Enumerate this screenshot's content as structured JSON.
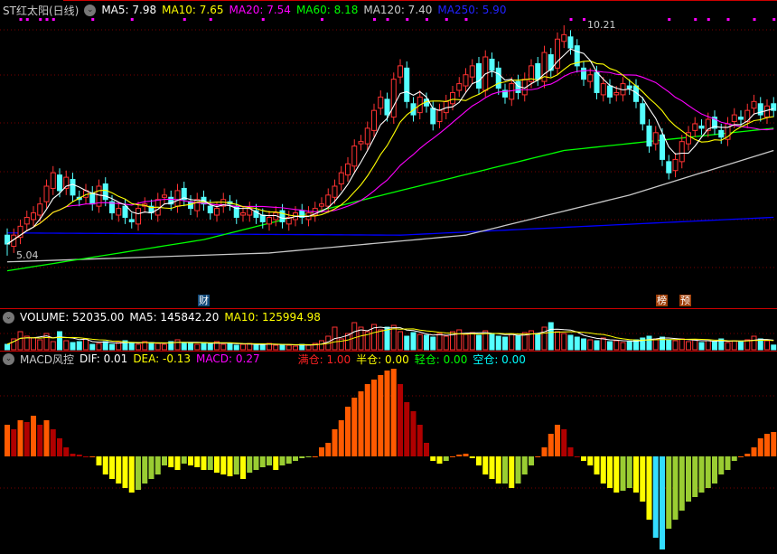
{
  "header": {
    "title": "ST红太阳(日线)",
    "ma5": "MA5: 7.98",
    "ma10": "MA10: 7.65",
    "ma20": "MA20: 7.54",
    "ma60": "MA60: 8.18",
    "ma120": "MA120: 7.40",
    "ma250": "MA250: 5.90"
  },
  "volume_header": {
    "title": "VOLUME: 52035.00",
    "ma5": "MA5: 145842.20",
    "ma10": "MA10: 125994.98"
  },
  "macd_header": {
    "title": "MACD风控",
    "dif": "DIF: 0.01",
    "dea": "DEA: -0.13",
    "macd": "MACD: 0.27",
    "full": "满仓: 1.00",
    "half": "半仓: 0.00",
    "light": "轻仓: 0.00",
    "empty": "空仓: 0.00"
  },
  "markers": {
    "cai": "财",
    "bang": "榜",
    "yu": "预"
  },
  "price_labels": {
    "high": "10.21",
    "low": "5.04"
  },
  "colors": {
    "up": "#ff3232",
    "down": "#54ffff",
    "ma5": "#ffffff",
    "ma10": "#ffff00",
    "ma20": "#ff00ff",
    "ma60": "#00ff00",
    "ma120": "#c8c8c8",
    "ma250": "#0000ff"
  },
  "chart_data": {
    "type": "candlestick",
    "title": "ST红太阳(日线)",
    "price_high": 10.21,
    "price_low": 5.04,
    "high_bar": 85,
    "low_bar": 0,
    "closes": [
      5.3,
      5.5,
      5.7,
      5.9,
      6.0,
      6.2,
      6.6,
      6.9,
      6.5,
      6.8,
      6.4,
      6.3,
      6.5,
      6.2,
      6.6,
      6.3,
      6.0,
      6.1,
      5.9,
      5.8,
      6.1,
      6.2,
      6.0,
      6.3,
      6.4,
      6.2,
      6.5,
      6.3,
      6.1,
      6.3,
      6.2,
      6.0,
      6.1,
      6.3,
      6.2,
      5.9,
      6.0,
      6.1,
      5.9,
      5.8,
      5.9,
      6.0,
      5.8,
      5.9,
      6.0,
      5.9,
      6.0,
      6.1,
      6.2,
      6.4,
      6.6,
      6.9,
      7.1,
      7.5,
      7.6,
      7.9,
      8.3,
      8.6,
      8.2,
      9.0,
      9.3,
      8.5,
      8.2,
      8.6,
      8.4,
      8.0,
      8.3,
      8.5,
      8.7,
      8.9,
      9.1,
      9.3,
      8.8,
      9.5,
      9.2,
      8.8,
      8.6,
      8.9,
      8.7,
      9.0,
      9.3,
      9.0,
      9.6,
      9.2,
      9.9,
      10.0,
      9.7,
      9.3,
      9.0,
      9.1,
      8.7,
      8.9,
      8.6,
      8.7,
      8.9,
      8.8,
      8.5,
      8.0,
      7.5,
      7.8,
      7.2,
      6.9,
      7.2,
      7.6,
      7.8,
      8.0,
      7.9,
      8.1,
      7.9,
      7.7,
      8.0,
      8.2,
      8.1,
      8.3,
      8.5,
      8.2,
      8.4,
      8.3
    ],
    "ma60": [
      [
        0,
        4.7
      ],
      [
        30,
        5.4
      ],
      [
        60,
        6.5
      ],
      [
        85,
        7.4
      ],
      [
        117,
        7.9
      ]
    ],
    "ma120": [
      [
        0,
        4.9
      ],
      [
        40,
        5.1
      ],
      [
        70,
        5.5
      ],
      [
        95,
        6.4
      ],
      [
        117,
        7.4
      ]
    ],
    "ma250": [
      [
        0,
        5.55
      ],
      [
        60,
        5.5
      ],
      [
        117,
        5.9
      ]
    ],
    "volume": [
      60000,
      120000,
      200000,
      150000,
      130000,
      110000,
      180000,
      90000,
      200000,
      100000,
      80000,
      90000,
      120000,
      60000,
      70000,
      90000,
      60000,
      80000,
      100000,
      70000,
      60000,
      90000,
      80000,
      70000,
      60000,
      90000,
      110000,
      80000,
      70000,
      60000,
      80000,
      70000,
      90000,
      60000,
      70000,
      50000,
      60000,
      70000,
      50000,
      60000,
      70000,
      50000,
      60000,
      50000,
      40000,
      60000,
      50000,
      70000,
      100000,
      150000,
      250000,
      120000,
      180000,
      300000,
      250000,
      200000,
      280000,
      220000,
      250000,
      270000,
      200000,
      150000,
      190000,
      170000,
      160000,
      140000,
      180000,
      150000,
      200000,
      220000,
      170000,
      190000,
      160000,
      210000,
      180000,
      150000,
      140000,
      170000,
      160000,
      190000,
      210000,
      180000,
      250000,
      300000,
      200000,
      180000,
      160000,
      140000,
      120000,
      110000,
      100000,
      130000,
      90000,
      100000,
      80000,
      90000,
      110000,
      130000,
      150000,
      120000,
      140000,
      110000,
      100000,
      120000,
      90000,
      110000,
      80000,
      100000,
      90000,
      120000,
      80000,
      100000,
      90000,
      110000,
      150000,
      120000,
      100000,
      52035
    ],
    "macd": [
      0.35,
      0.3,
      0.4,
      0.38,
      0.45,
      0.35,
      0.4,
      0.3,
      0.2,
      0.1,
      0.03,
      0.02,
      0.0,
      0.0,
      -0.1,
      -0.2,
      -0.25,
      -0.3,
      -0.35,
      -0.4,
      -0.37,
      -0.3,
      -0.25,
      -0.2,
      -0.1,
      -0.12,
      -0.15,
      -0.08,
      -0.1,
      -0.12,
      -0.15,
      -0.15,
      -0.18,
      -0.2,
      -0.22,
      -0.2,
      -0.25,
      -0.18,
      -0.15,
      -0.12,
      -0.1,
      -0.15,
      -0.1,
      -0.08,
      -0.05,
      -0.02,
      -0.01,
      0.0,
      0.1,
      0.15,
      0.3,
      0.4,
      0.55,
      0.65,
      0.72,
      0.8,
      0.85,
      0.9,
      0.95,
      0.97,
      0.8,
      0.6,
      0.5,
      0.35,
      0.15,
      -0.05,
      -0.08,
      -0.05,
      0.0,
      0.02,
      0.03,
      -0.02,
      -0.1,
      -0.2,
      -0.25,
      -0.3,
      -0.3,
      -0.35,
      -0.3,
      -0.2,
      -0.1,
      0.0,
      0.1,
      0.25,
      0.35,
      0.3,
      0.1,
      0.0,
      -0.05,
      -0.1,
      -0.2,
      -0.3,
      -0.35,
      -0.4,
      -0.38,
      -0.35,
      -0.4,
      -0.5,
      -0.7,
      -0.9,
      -1.03,
      -0.8,
      -0.7,
      -0.6,
      -0.5,
      -0.45,
      -0.4,
      -0.35,
      -0.3,
      -0.2,
      -0.15,
      -0.05,
      0.0,
      0.03,
      0.1,
      0.2,
      0.25,
      0.27
    ],
    "signal_dot_bars": [
      2,
      3,
      5,
      6,
      7,
      13,
      19,
      27,
      31,
      39,
      48,
      56,
      58,
      61,
      64,
      67,
      70,
      86,
      88,
      101,
      105,
      107,
      110,
      114,
      117
    ]
  }
}
